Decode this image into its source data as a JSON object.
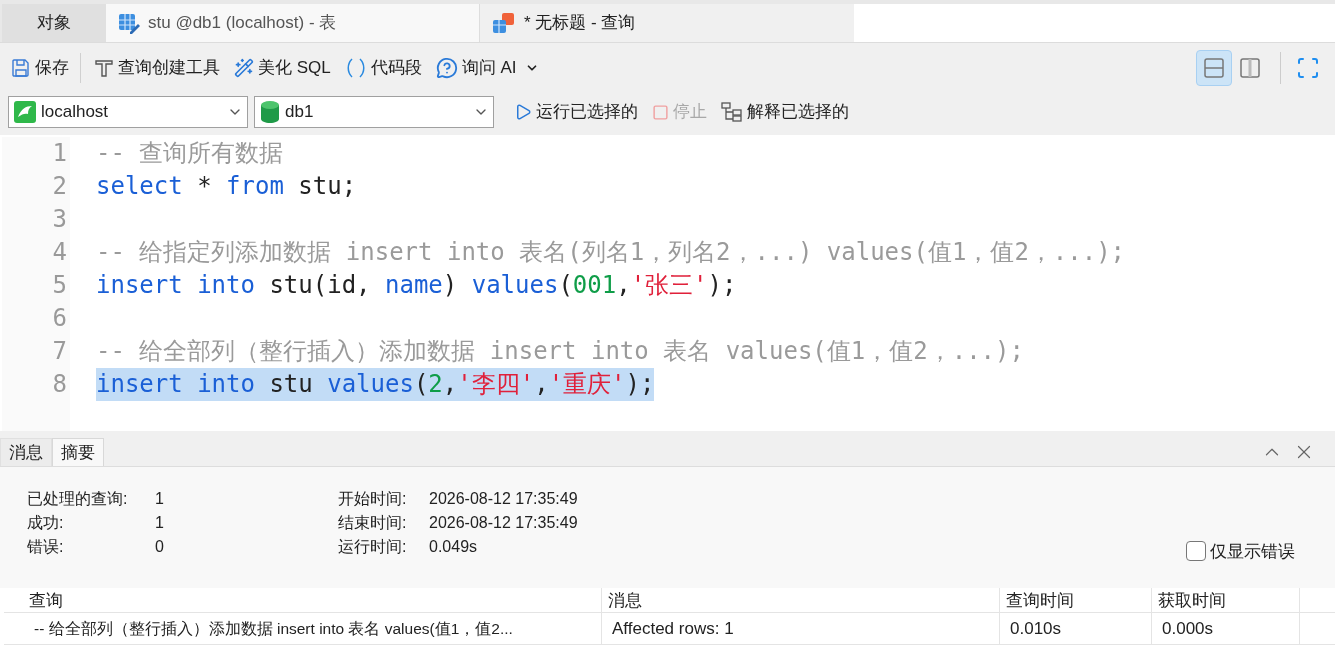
{
  "tabs": [
    {
      "label": "对象",
      "kind": "plain",
      "selected": false
    },
    {
      "label": "stu @db1 (localhost) - 表",
      "kind": "table",
      "selected": false
    },
    {
      "label": "* 无标题 - 查询",
      "kind": "query",
      "selected": true
    }
  ],
  "toolbar": [
    {
      "label": "保存",
      "kind": "save"
    },
    {
      "label": "查询创建工具",
      "kind": "builder"
    },
    {
      "label": "美化 SQL",
      "kind": "beautify"
    },
    {
      "label": "代码段",
      "kind": "snippet"
    },
    {
      "label": "询问 AI",
      "kind": "ai"
    }
  ],
  "layout_toggles": [
    {
      "kind": "rows",
      "selected": true
    },
    {
      "kind": "columns",
      "selected": false
    }
  ],
  "connection": {
    "value": "localhost"
  },
  "database": {
    "value": "db1"
  },
  "actions": [
    {
      "label": "运行已选择的",
      "kind": "run",
      "disabled": false
    },
    {
      "label": "停止",
      "kind": "stop",
      "disabled": true
    },
    {
      "label": "解释已选择的",
      "kind": "explain",
      "disabled": false
    }
  ],
  "editor": {
    "lines": [
      {
        "number": "1",
        "selected": false,
        "tokens": [
          {
            "kind": "comment",
            "text": "-- 查询所有数据"
          }
        ]
      },
      {
        "number": "2",
        "selected": false,
        "tokens": [
          {
            "kind": "keyword",
            "text": "select"
          },
          {
            "kind": "plain",
            "text": " * "
          },
          {
            "kind": "keyword",
            "text": "from"
          },
          {
            "kind": "plain",
            "text": " stu;"
          }
        ]
      },
      {
        "number": "3",
        "selected": false
      },
      {
        "number": "4",
        "selected": false,
        "tokens": [
          {
            "kind": "comment",
            "text": "-- 给指定列添加数据 insert into 表名(列名1，列名2，...) values(值1，值2，...);"
          }
        ]
      },
      {
        "number": "5",
        "selected": false,
        "tokens": [
          {
            "kind": "keyword",
            "text": "insert into"
          },
          {
            "kind": "plain",
            "text": " stu(id, "
          },
          {
            "kind": "keyword",
            "text": "name"
          },
          {
            "kind": "plain",
            "text": ") "
          },
          {
            "kind": "keyword",
            "text": "values"
          },
          {
            "kind": "plain",
            "text": "("
          },
          {
            "kind": "number",
            "text": "001"
          },
          {
            "kind": "plain",
            "text": ","
          },
          {
            "kind": "string",
            "text": "'张三'"
          },
          {
            "kind": "plain",
            "text": ");"
          }
        ]
      },
      {
        "number": "6",
        "selected": false
      },
      {
        "number": "7",
        "selected": false,
        "tokens": [
          {
            "kind": "comment",
            "text": "-- 给全部列（整行插入）添加数据 insert into 表名 values(值1，值2，...);"
          }
        ]
      },
      {
        "number": "8",
        "selected": true,
        "tokens": [
          {
            "kind": "keyword",
            "text": "insert into"
          },
          {
            "kind": "plain",
            "text": " stu "
          },
          {
            "kind": "keyword",
            "text": "values"
          },
          {
            "kind": "plain",
            "text": "("
          },
          {
            "kind": "number",
            "text": "2"
          },
          {
            "kind": "plain",
            "text": ","
          },
          {
            "kind": "string",
            "text": "'李四'"
          },
          {
            "kind": "plain",
            "text": ","
          },
          {
            "kind": "string",
            "text": "'重庆'"
          },
          {
            "kind": "plain",
            "text": ");"
          }
        ]
      }
    ]
  },
  "results": {
    "tabs": [
      {
        "label": "消息",
        "selected": false
      },
      {
        "label": "摘要",
        "selected": true
      }
    ],
    "summary_left": [
      {
        "label": "已处理的查询:",
        "value": "1"
      },
      {
        "label": "成功:",
        "value": "1"
      },
      {
        "label": "错误:",
        "value": "0"
      }
    ],
    "summary_right": [
      {
        "label": "开始时间:",
        "value": "2026-08-12 17:35:49"
      },
      {
        "label": "结束时间:",
        "value": "2026-08-12 17:35:49"
      },
      {
        "label": "运行时间:",
        "value": "0.049s"
      }
    ],
    "only_errors": {
      "label": "仅显示错误",
      "checked": false
    },
    "table": {
      "columns": [
        "查询",
        "消息",
        "查询时间",
        "获取时间"
      ],
      "rows": [
        [
          "-- 给全部列（整行插入）添加数据 insert into 表名 values(值1，值2...",
          "Affected rows: 1",
          "0.010s",
          "0.000s"
        ]
      ]
    }
  }
}
